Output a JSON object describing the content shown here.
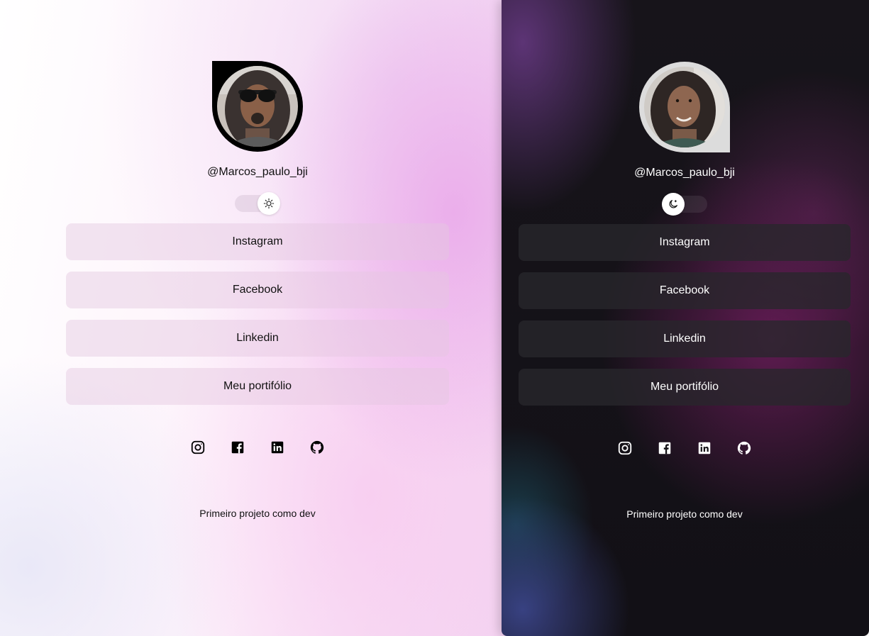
{
  "light": {
    "profile": {
      "handle": "@Marcos_paulo_bji"
    },
    "theme_toggle": {
      "mode": "light",
      "icon": "sun-icon"
    },
    "links": [
      {
        "label": "Instagram"
      },
      {
        "label": "Facebook"
      },
      {
        "label": "Linkedin"
      },
      {
        "label": "Meu portifólio"
      }
    ],
    "social": [
      "instagram-icon",
      "facebook-icon",
      "linkedin-icon",
      "github-icon"
    ],
    "footer": "Primeiro projeto como dev"
  },
  "dark": {
    "profile": {
      "handle": "@Marcos_paulo_bji"
    },
    "theme_toggle": {
      "mode": "dark",
      "icon": "moon-icon"
    },
    "links": [
      {
        "label": "Instagram"
      },
      {
        "label": "Facebook"
      },
      {
        "label": "Linkedin"
      },
      {
        "label": "Meu portifólio"
      }
    ],
    "social": [
      "instagram-icon",
      "facebook-icon",
      "linkedin-icon",
      "github-icon"
    ],
    "footer": "Primeiro projeto como dev"
  },
  "colors": {
    "light_accent": "#ecb2ec",
    "dark_bg": "#131116",
    "dark_accent": "#6e1f5e"
  }
}
